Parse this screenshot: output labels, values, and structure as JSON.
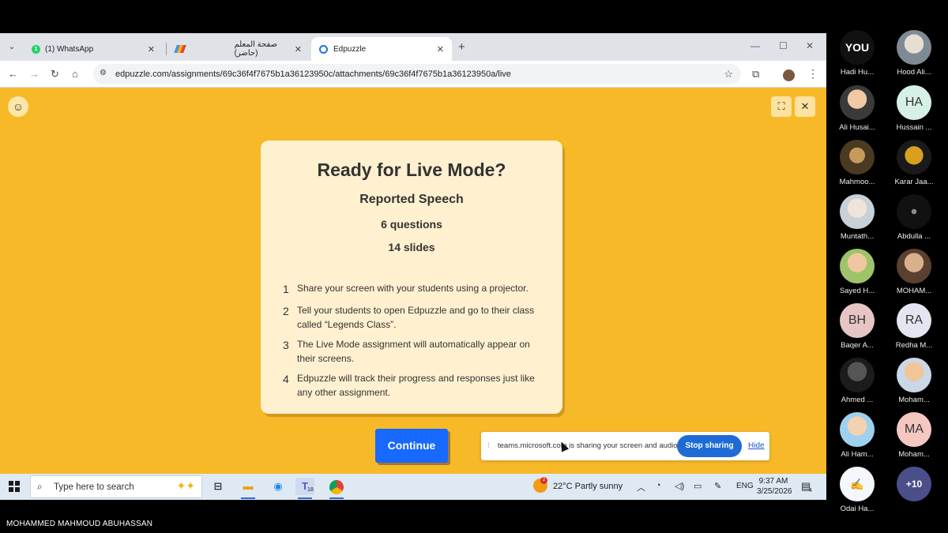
{
  "browser": {
    "tabs": [
      {
        "label": "(1) WhatsApp",
        "badge": "1"
      },
      {
        "label": "صفحة المعلم (حاضر)"
      },
      {
        "label": "Edpuzzle"
      }
    ],
    "url": "edpuzzle.com/assignments/69c36f4f7675b1a36123950c/attachments/69c36f4f7675b1a36123950a/live"
  },
  "live_mode": {
    "title": "Ready for Live Mode?",
    "lesson": "Reported Speech",
    "questions": "6 questions",
    "slides": "14 slides",
    "steps": [
      {
        "num": "1",
        "text": "Share your screen with your students using a projector."
      },
      {
        "num": "2",
        "text": "Tell your students to open Edpuzzle and go to their class called “Legends Class”."
      },
      {
        "num": "3",
        "text": "The Live Mode assignment will automatically appear on their screens."
      },
      {
        "num": "4",
        "text": "Edpuzzle will track their progress and responses just like any other assignment."
      }
    ],
    "continue_label": "Continue"
  },
  "sharing_bar": {
    "message": "teams.microsoft.com is sharing your screen and audio.",
    "stop_label": "Stop sharing",
    "hide_label": "Hide"
  },
  "taskbar": {
    "search_placeholder": "Type here to search",
    "teams_badge": "18",
    "weather_badge": "2",
    "weather": "22°C  Partly sunny",
    "language": "ENG",
    "time": "9:37 AM",
    "date": "3/25/2026",
    "notifications": "4"
  },
  "participants": [
    {
      "name": "Hadi Hu...",
      "avatar_text": "YOU"
    },
    {
      "name": "Hood Ali..."
    },
    {
      "name": "Ali Husai..."
    },
    {
      "name": "Hussain ...",
      "initials": "HA"
    },
    {
      "name": "Mahmoo..."
    },
    {
      "name": "Karar Jaa..."
    },
    {
      "name": "Muntath..."
    },
    {
      "name": "Abdulla ..."
    },
    {
      "name": "Sayed H..."
    },
    {
      "name": "MOHAM..."
    },
    {
      "name": "Baqer A...",
      "initials": "BH"
    },
    {
      "name": "Redha M...",
      "initials": "RA"
    },
    {
      "name": "Ahmed ..."
    },
    {
      "name": "Moham..."
    },
    {
      "name": "Ali Ham..."
    },
    {
      "name": "Moham...",
      "initials": "MA"
    },
    {
      "name": "Odai Ha..."
    },
    {
      "name": "",
      "initials": "+10"
    }
  ],
  "presenter_name": "MOHAMMED MAHMOUD ABUHASSAN",
  "colors": {
    "edpuzzle_background": "#f7b928",
    "card_background": "#fff0cf",
    "continue_button": "#1769ff",
    "stop_sharing_button": "#1f6bd6"
  }
}
